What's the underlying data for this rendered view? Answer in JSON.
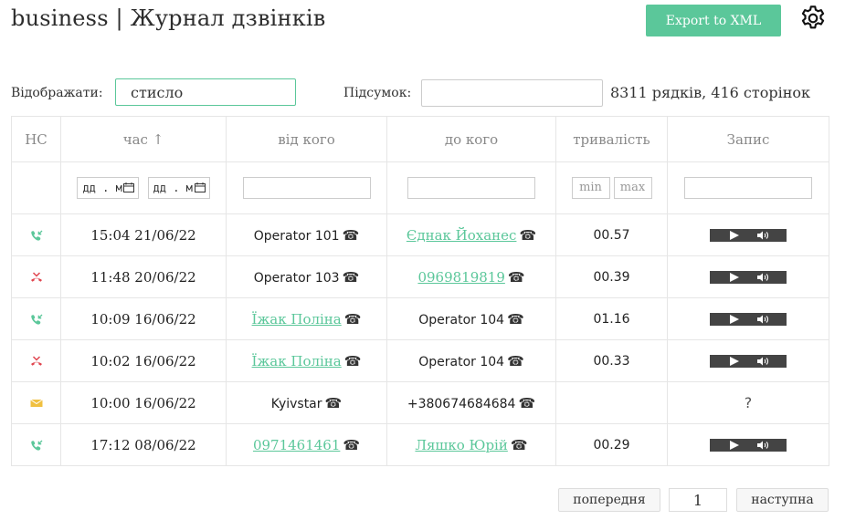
{
  "header": {
    "title": "business | Журнал дзвінків",
    "export_label": "Export to XML",
    "settings_icon": "gear-icon"
  },
  "controls": {
    "display_label": "Відображати:",
    "display_value": "стисло",
    "summary_label": "Підсумок:",
    "summary_value": "",
    "rows_info": "8311 рядків, 416 сторінок"
  },
  "table": {
    "columns": [
      "НС",
      "час ↑",
      "від кого",
      "до кого",
      "тривалість",
      "Запис"
    ],
    "filters": {
      "date_from_placeholder": "дд . м",
      "date_to_placeholder": "дд . м",
      "min_placeholder": "min",
      "max_placeholder": "max"
    },
    "rows": [
      {
        "status": "incoming-call-icon",
        "time": "15:04 21/06/22",
        "from": "Operator 101",
        "from_link": false,
        "to": "Єднак Йоханес",
        "to_link": true,
        "duration": "00.57",
        "record": "player"
      },
      {
        "status": "missed-call-icon",
        "time": "11:48 20/06/22",
        "from": "Operator 103",
        "from_link": false,
        "to": "0969819819",
        "to_link": true,
        "duration": "00.39",
        "record": "player"
      },
      {
        "status": "incoming-call-icon",
        "time": "10:09 16/06/22",
        "from": "Їжак Поліна",
        "from_link": true,
        "to": "Operator 104",
        "to_link": false,
        "duration": "01.16",
        "record": "player"
      },
      {
        "status": "missed-call-icon",
        "time": "10:02 16/06/22",
        "from": "Їжак Поліна",
        "from_link": true,
        "to": "Operator 104",
        "to_link": false,
        "duration": "00.33",
        "record": "player"
      },
      {
        "status": "sms-icon",
        "time": "10:00 16/06/22",
        "from": "Kyivstar",
        "from_link": false,
        "to": "+380674684684",
        "to_link": false,
        "duration": "",
        "record": "?"
      },
      {
        "status": "incoming-call-icon",
        "time": "17:12 08/06/22",
        "from": "0971461461",
        "from_link": true,
        "to": "Ляшко Юрій",
        "to_link": true,
        "duration": "00.29",
        "record": "player"
      }
    ]
  },
  "pager": {
    "prev_label": "попередня",
    "page_value": "1",
    "next_label": "наступна"
  },
  "colors": {
    "accent": "#5bc79a",
    "missed": "#e0454f",
    "sms": "#f0c040",
    "player": "#444444"
  }
}
